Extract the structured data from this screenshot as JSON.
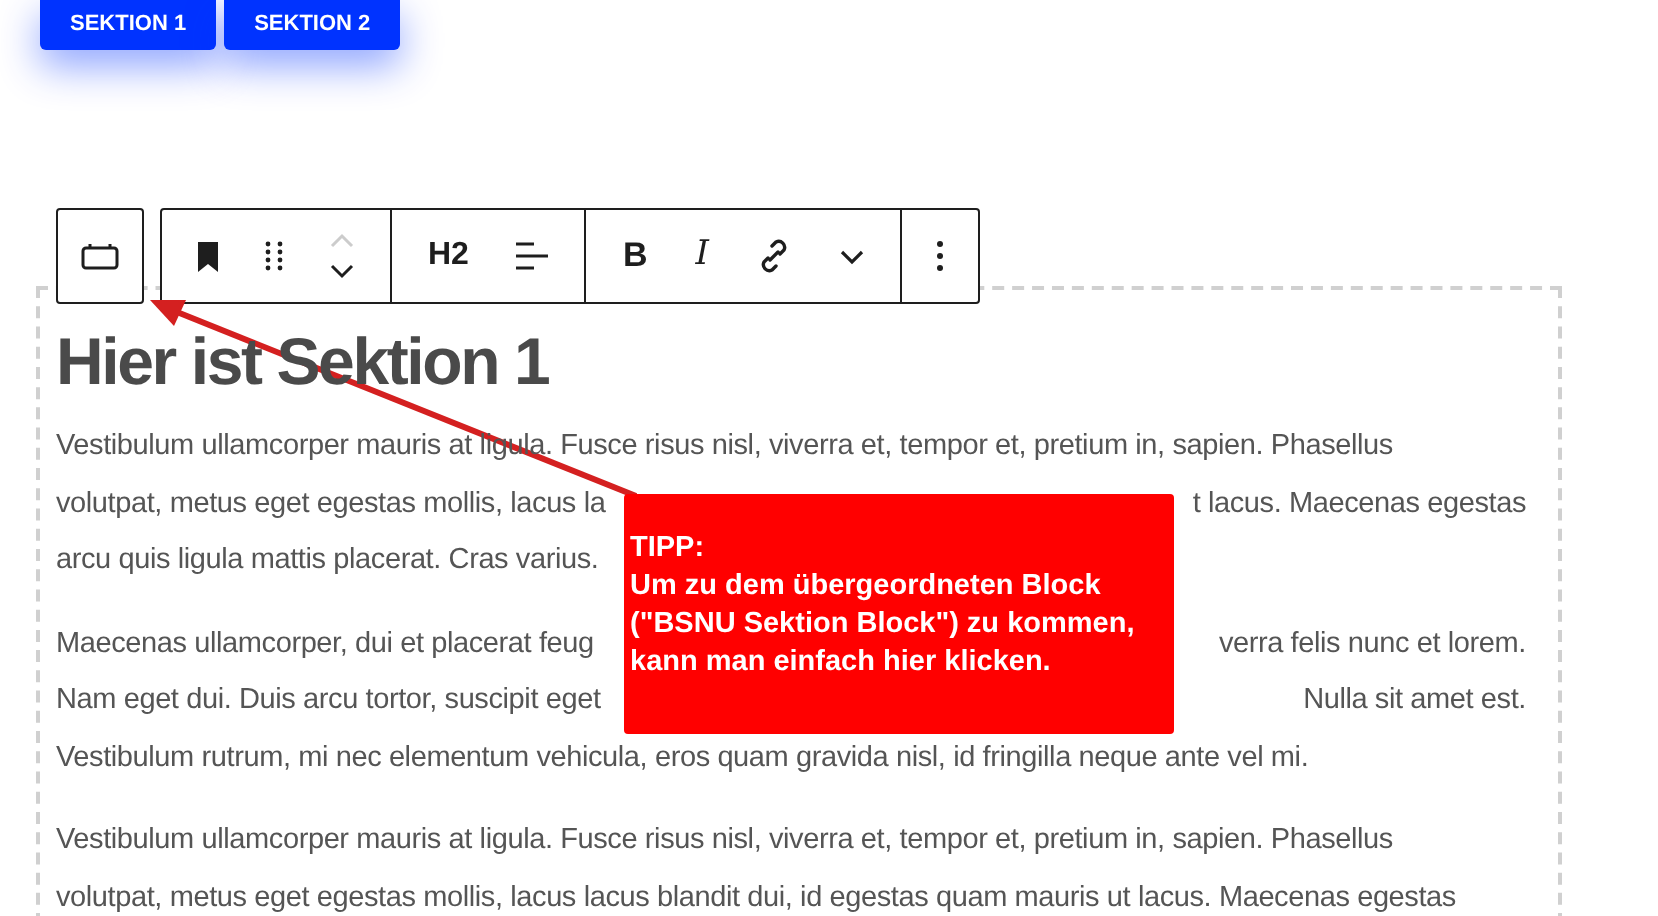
{
  "section_buttons": [
    {
      "label": "SEKTION 1"
    },
    {
      "label": "SEKTION 2"
    }
  ],
  "toolbar": {
    "groups": [
      [
        {
          "kind": "parent"
        }
      ],
      [
        {
          "kind": "bookmark"
        },
        {
          "kind": "drag"
        },
        {
          "kind": "mover"
        }
      ],
      [
        {
          "kind": "text",
          "label": "H2"
        },
        {
          "kind": "align"
        }
      ],
      [
        {
          "kind": "bold",
          "label": "B"
        },
        {
          "kind": "italic",
          "label": "I"
        },
        {
          "kind": "link"
        },
        {
          "kind": "more"
        }
      ],
      [
        {
          "kind": "options"
        }
      ]
    ]
  },
  "heading": "Hier ist Sektion 1",
  "paragraphs": [
    [
      {
        "left": "Vestibulum ullamcorper mauris at ligula. Fusce risus nisl, viverra et, tempor et, pretium in, sapien. Phasellus"
      },
      {
        "left": "volutpat, metus eget egestas mollis, lacus la",
        "right": "t lacus. Maecenas egestas"
      },
      {
        "left": "arcu quis ligula mattis placerat. Cras varius."
      }
    ],
    [
      {
        "left": "Maecenas ullamcorper, dui et placerat feug",
        "right": "verra felis nunc et lorem."
      },
      {
        "left": "Nam eget dui. Duis arcu tortor, suscipit eget",
        "right": "Nulla sit amet est."
      },
      {
        "left": "Vestibulum rutrum, mi nec elementum vehicula, eros quam gravida nisl, id fringilla neque ante vel mi."
      }
    ],
    [
      {
        "left": "Vestibulum ullamcorper mauris at ligula. Fusce risus nisl, viverra et, tempor et, pretium in, sapien. Phasellus"
      },
      {
        "left": "volutpat, metus eget egestas mollis, lacus lacus blandit dui, id egestas quam mauris ut lacus. Maecenas egestas"
      }
    ]
  ],
  "tip": {
    "title": "TIPP:",
    "text": "Um zu dem übergeordneten Block (\"BSNU Sektion Block\") zu kommen, kann man einfach hier klicken."
  }
}
